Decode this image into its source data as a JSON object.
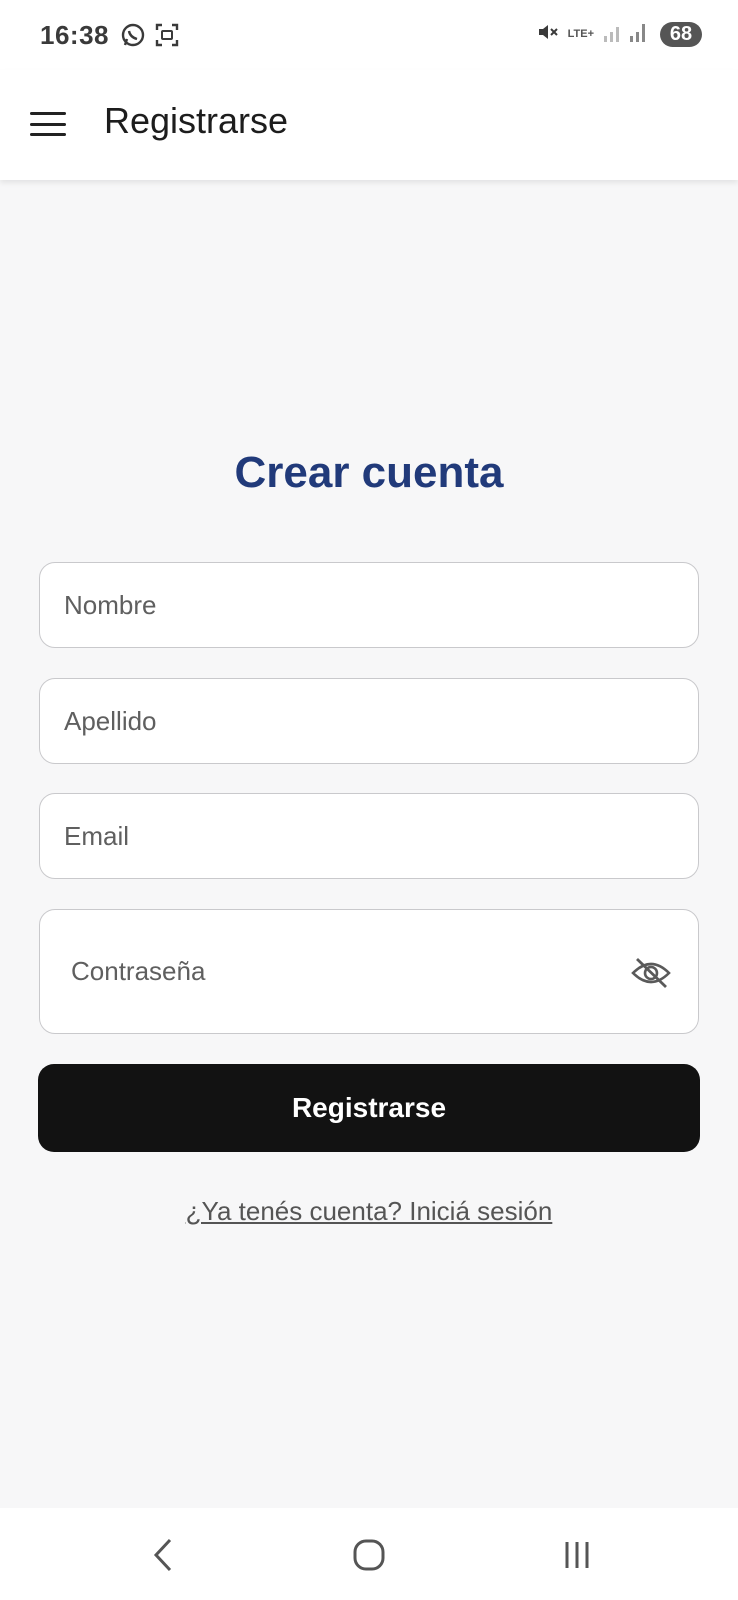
{
  "status_bar": {
    "time": "16:38",
    "network": "LTE+",
    "battery": "68",
    "icons": [
      "whatsapp-icon",
      "screenshot-icon",
      "mute-icon",
      "signal-icon",
      "battery-icon"
    ]
  },
  "app_bar": {
    "title": "Registrarse",
    "menu_icon": "hamburger-menu-icon"
  },
  "form": {
    "heading": "Crear cuenta",
    "fields": {
      "nombre": {
        "placeholder": "Nombre",
        "value": ""
      },
      "apellido": {
        "placeholder": "Apellido",
        "value": ""
      },
      "email": {
        "placeholder": "Email",
        "value": ""
      },
      "password": {
        "placeholder": "Contraseña",
        "value": "",
        "toggle_icon": "eye-off-icon"
      }
    },
    "submit_label": "Registrarse",
    "login_link": "¿Ya tenés cuenta? Iniciá sesión"
  },
  "nav_bar": {
    "buttons": [
      "back-icon",
      "home-icon",
      "recents-icon"
    ]
  },
  "colors": {
    "heading": "#213a7a",
    "button_bg": "#121212",
    "page_bg": "#f7f7f8"
  }
}
